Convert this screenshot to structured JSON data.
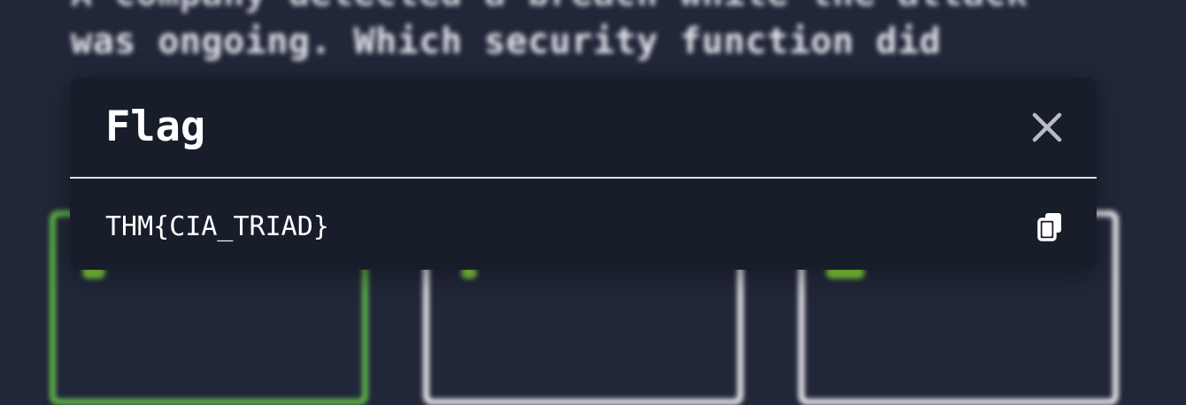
{
  "background": {
    "question_line_1": "A company detected a breach while the attack",
    "question_line_2": "was ongoing. Which security function did"
  },
  "modal": {
    "title": "Flag",
    "flag_value": "THM{CIA_TRIAD}",
    "close_icon": "close-icon",
    "copy_icon": "copy-icon"
  },
  "colors": {
    "page_background": "#212639",
    "modal_background": "#181d2a",
    "text": "#ffffff",
    "selected_card_border": "#5fb548",
    "card_border": "#e8e8ea"
  }
}
